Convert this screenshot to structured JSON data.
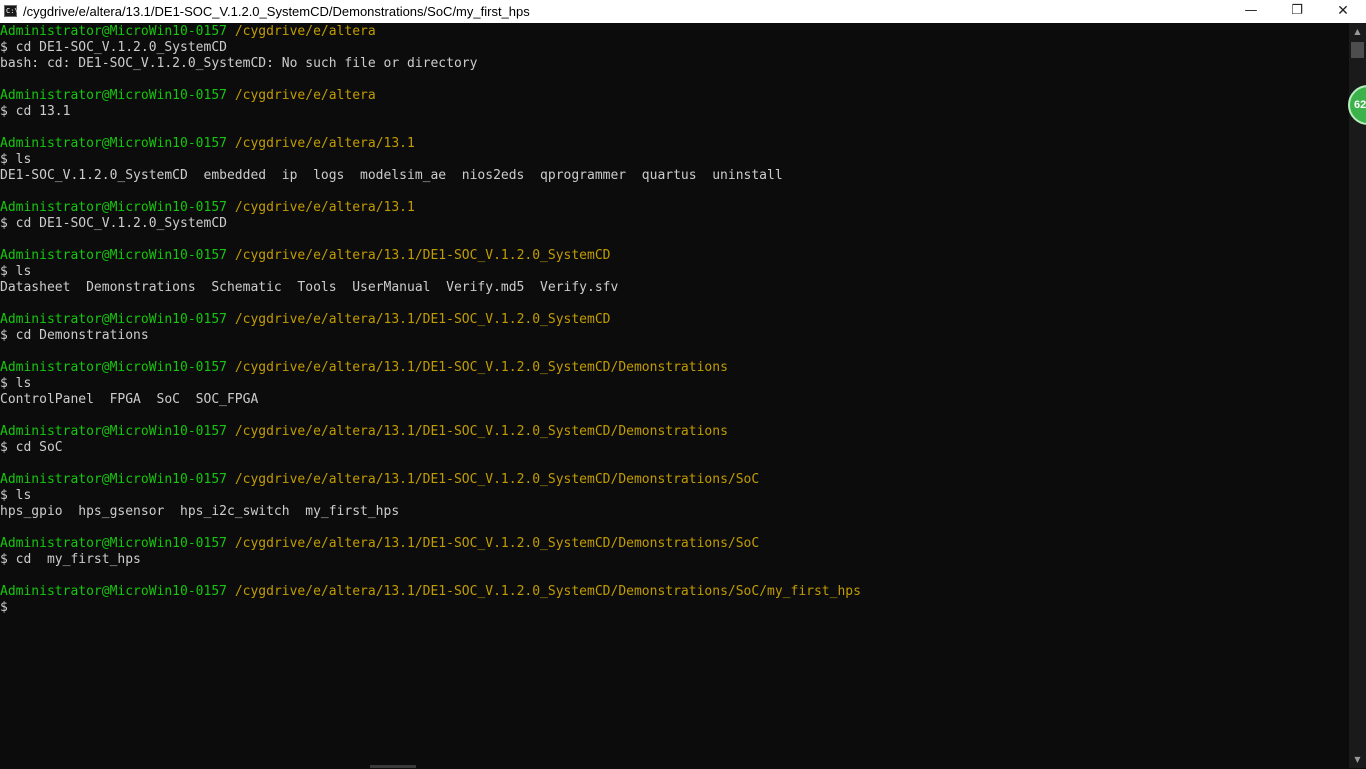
{
  "window": {
    "title": "/cygdrive/e/altera/13.1/DE1-SOC_V.1.2.0_SystemCD/Demonstrations/SoC/my_first_hps",
    "icon": "terminal-icon",
    "icon_text": "C:\\"
  },
  "controls": {
    "minimize": "—",
    "maximize": "❐",
    "close": "✕"
  },
  "colors": {
    "background": "#0c0c0c",
    "text": "#cccccc",
    "user": "#16c60c",
    "path": "#c19c00"
  },
  "terminal": {
    "lines": [
      {
        "type": "prompt",
        "user": "Administrator@MicroWin10-0157",
        "path": "/cygdrive/e/altera"
      },
      {
        "type": "text",
        "text": "$ cd DE1-SOC_V.1.2.0_SystemCD"
      },
      {
        "type": "text",
        "text": "bash: cd: DE1-SOC_V.1.2.0_SystemCD: No such file or directory"
      },
      {
        "type": "text",
        "text": ""
      },
      {
        "type": "prompt",
        "user": "Administrator@MicroWin10-0157",
        "path": "/cygdrive/e/altera"
      },
      {
        "type": "text",
        "text": "$ cd 13.1"
      },
      {
        "type": "text",
        "text": ""
      },
      {
        "type": "prompt",
        "user": "Administrator@MicroWin10-0157",
        "path": "/cygdrive/e/altera/13.1"
      },
      {
        "type": "text",
        "text": "$ ls"
      },
      {
        "type": "text",
        "text": "DE1-SOC_V.1.2.0_SystemCD  embedded  ip  logs  modelsim_ae  nios2eds  qprogrammer  quartus  uninstall"
      },
      {
        "type": "text",
        "text": ""
      },
      {
        "type": "prompt",
        "user": "Administrator@MicroWin10-0157",
        "path": "/cygdrive/e/altera/13.1"
      },
      {
        "type": "text",
        "text": "$ cd DE1-SOC_V.1.2.0_SystemCD"
      },
      {
        "type": "text",
        "text": ""
      },
      {
        "type": "prompt",
        "user": "Administrator@MicroWin10-0157",
        "path": "/cygdrive/e/altera/13.1/DE1-SOC_V.1.2.0_SystemCD"
      },
      {
        "type": "text",
        "text": "$ ls"
      },
      {
        "type": "text",
        "text": "Datasheet  Demonstrations  Schematic  Tools  UserManual  Verify.md5  Verify.sfv"
      },
      {
        "type": "text",
        "text": ""
      },
      {
        "type": "prompt",
        "user": "Administrator@MicroWin10-0157",
        "path": "/cygdrive/e/altera/13.1/DE1-SOC_V.1.2.0_SystemCD"
      },
      {
        "type": "text",
        "text": "$ cd Demonstrations"
      },
      {
        "type": "text",
        "text": ""
      },
      {
        "type": "prompt",
        "user": "Administrator@MicroWin10-0157",
        "path": "/cygdrive/e/altera/13.1/DE1-SOC_V.1.2.0_SystemCD/Demonstrations"
      },
      {
        "type": "text",
        "text": "$ ls"
      },
      {
        "type": "text",
        "text": "ControlPanel  FPGA  SoC  SOC_FPGA"
      },
      {
        "type": "text",
        "text": ""
      },
      {
        "type": "prompt",
        "user": "Administrator@MicroWin10-0157",
        "path": "/cygdrive/e/altera/13.1/DE1-SOC_V.1.2.0_SystemCD/Demonstrations"
      },
      {
        "type": "text",
        "text": "$ cd SoC"
      },
      {
        "type": "text",
        "text": ""
      },
      {
        "type": "prompt",
        "user": "Administrator@MicroWin10-0157",
        "path": "/cygdrive/e/altera/13.1/DE1-SOC_V.1.2.0_SystemCD/Demonstrations/SoC"
      },
      {
        "type": "text",
        "text": "$ ls"
      },
      {
        "type": "text",
        "text": "hps_gpio  hps_gsensor  hps_i2c_switch  my_first_hps"
      },
      {
        "type": "text",
        "text": ""
      },
      {
        "type": "prompt",
        "user": "Administrator@MicroWin10-0157",
        "path": "/cygdrive/e/altera/13.1/DE1-SOC_V.1.2.0_SystemCD/Demonstrations/SoC"
      },
      {
        "type": "text",
        "text": "$ cd  my_first_hps"
      },
      {
        "type": "text",
        "text": ""
      },
      {
        "type": "prompt",
        "user": "Administrator@MicroWin10-0157",
        "path": "/cygdrive/e/altera/13.1/DE1-SOC_V.1.2.0_SystemCD/Demonstrations/SoC/my_first_hps"
      },
      {
        "type": "text",
        "text": "$"
      }
    ]
  },
  "scrollbar": {
    "up_arrow": "▲",
    "down_arrow": "▼"
  },
  "overlay_badge": {
    "text": "62"
  }
}
